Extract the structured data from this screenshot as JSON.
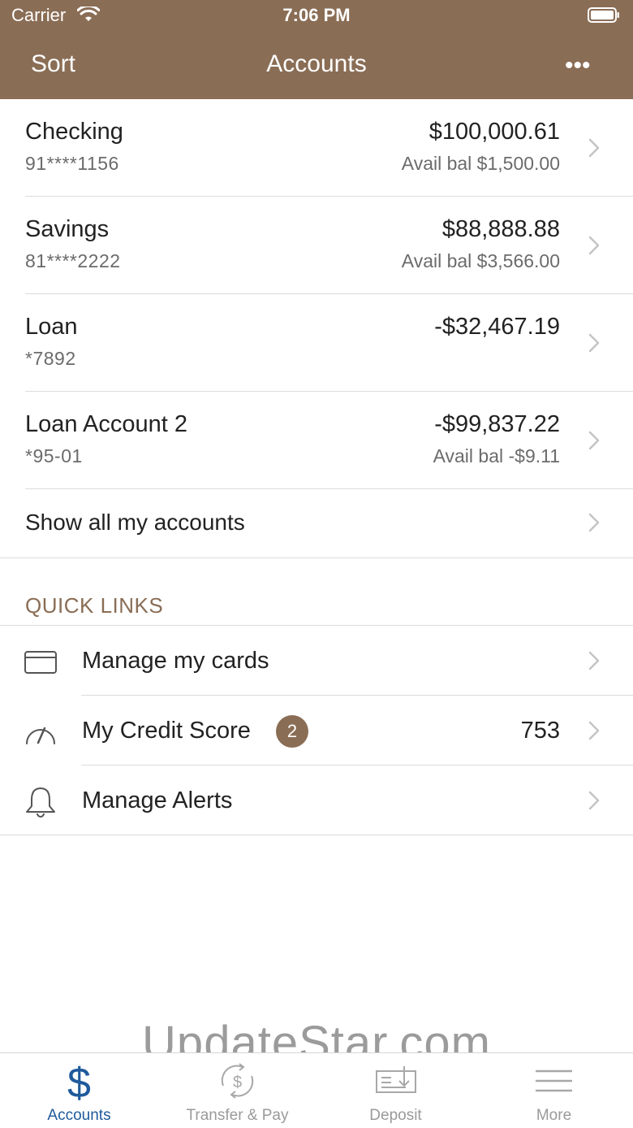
{
  "status_bar": {
    "carrier": "Carrier",
    "time": "7:06 PM"
  },
  "nav": {
    "left": "Sort",
    "title": "Accounts",
    "more": "•••"
  },
  "accounts": [
    {
      "name": "Checking",
      "number": "91****1156",
      "balance": "$100,000.61",
      "avail": "Avail bal $1,500.00"
    },
    {
      "name": "Savings",
      "number": "81****2222",
      "balance": "$88,888.88",
      "avail": "Avail bal $3,566.00"
    },
    {
      "name": "Loan",
      "number": "*7892",
      "balance": "-$32,467.19",
      "avail": ""
    },
    {
      "name": "Loan Account 2",
      "number": "*95-01",
      "balance": "-$99,837.22",
      "avail": "Avail bal -$9.11"
    }
  ],
  "show_all": "Show all my accounts",
  "quick_links": {
    "header": "QUICK LINKS",
    "items": [
      {
        "label": "Manage my cards",
        "icon": "credit-card-icon"
      },
      {
        "label": "My Credit Score",
        "icon": "gauge-icon",
        "badge": "2",
        "value": "753"
      },
      {
        "label": "Manage Alerts",
        "icon": "bell-icon"
      }
    ]
  },
  "watermark": "UpdateStar.com",
  "tabs": [
    {
      "label": "Accounts",
      "icon": "dollar-icon",
      "active": true
    },
    {
      "label": "Transfer & Pay",
      "icon": "transfer-icon"
    },
    {
      "label": "Deposit",
      "icon": "deposit-check-icon"
    },
    {
      "label": "More",
      "icon": "menu-icon"
    }
  ],
  "colors": {
    "brand": "#8a6d55",
    "tab_active": "#1f5a9b",
    "tab_inactive": "#9a9a9a"
  }
}
